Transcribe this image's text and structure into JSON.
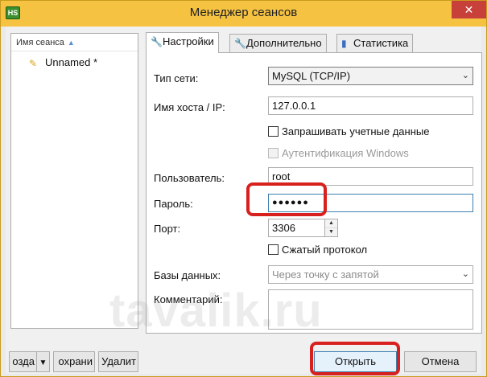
{
  "window": {
    "title": "Менеджер сеансов",
    "app_icon_text": "HS",
    "close_glyph": "✕"
  },
  "sessions": {
    "column_header": "Имя сеанса",
    "items": [
      {
        "label": "Unnamed *"
      }
    ]
  },
  "tabs": [
    {
      "label": "Настройки",
      "icon": "wrench-icon",
      "active": true
    },
    {
      "label": "Дополнительно",
      "icon": "wrench-icon",
      "active": false
    },
    {
      "label": "Статистика",
      "icon": "bar-chart-icon",
      "active": false
    }
  ],
  "settings": {
    "network_type_label": "Тип сети:",
    "network_type_value": "MySQL (TCP/IP)",
    "host_label": "Имя хоста / IP:",
    "host_value": "127.0.0.1",
    "prompt_credentials_label": "Запрашивать учетные данные",
    "windows_auth_label": "Аутентификация Windows",
    "user_label": "Пользователь:",
    "user_value": "root",
    "password_label": "Пароль:",
    "password_value": "●●●●●●",
    "port_label": "Порт:",
    "port_value": "3306",
    "compressed_label": "Сжатый протокол",
    "databases_label": "Базы данных:",
    "databases_placeholder": "Через точку с запятой",
    "comment_label": "Комментарий:"
  },
  "buttons": {
    "new": "озда",
    "save": "охрани",
    "delete": "Удалит",
    "open": "Открыть",
    "cancel": "Отмена"
  },
  "watermark": "tavalik.ru",
  "colors": {
    "titlebar": "#f5c242",
    "highlight": "#d8201e",
    "close": "#c7413a"
  }
}
